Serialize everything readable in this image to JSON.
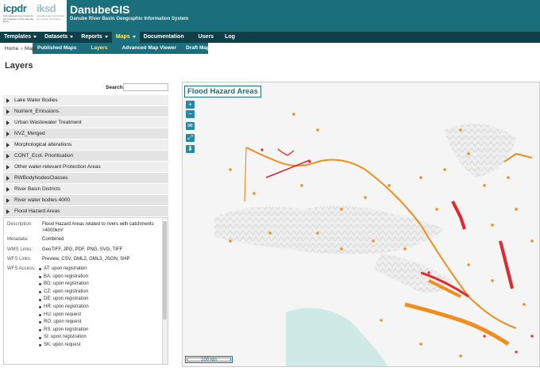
{
  "header": {
    "logo_icpdr": "icpdr",
    "logo_iksd": "iksd",
    "logo_sub": "International Commission for the Protection of the Danube River",
    "logo_sub2": "Internationale Kommission zum Schutz der Donau",
    "title": "DanubeGIS",
    "subtitle": "Danube River Basin Geographic Information System"
  },
  "mainnav": {
    "items": [
      {
        "label": "Templates",
        "caret": true
      },
      {
        "label": "Datasets",
        "caret": true
      },
      {
        "label": "Reports",
        "caret": true
      },
      {
        "label": "Maps",
        "caret": true,
        "active": true
      },
      {
        "label": "Documentation"
      },
      {
        "label": "Users"
      },
      {
        "label": "Log"
      }
    ]
  },
  "subnav": {
    "items": [
      "Published Maps",
      "Layers",
      "Advanced Map Viewer",
      "Draft Maps"
    ],
    "active_index": 1
  },
  "breadcrumb": {
    "home": "Home",
    "sep": "»",
    "current": "Maps"
  },
  "page_title": "Layers",
  "search": {
    "label": "Search:",
    "value": ""
  },
  "layers": [
    "Lake Water Bodies",
    "Nutrient_Emissions",
    "Urban Wastewater Treatment",
    "NVZ_Merged",
    "Morphological alterations",
    "CONT_Ecol. Prioritisation",
    "Other water-relevant Protection Areas",
    "RWBodyNodesClasses",
    "River Basin Districts",
    "River water bodies 4000",
    "Flood Hazard Areas"
  ],
  "detail": {
    "description_label": "Description:",
    "description": "Flood Hazard Areas related to rivers with catchments >4000km²",
    "metadata_label": "Metadata:",
    "metadata": "Combined",
    "wms_label": "WMS Links:",
    "wms": "GeoTIFF, JPG, PDF, PNG, SVG, TIFF",
    "wfs_links_label": "WFS Links:",
    "wfs_links": "Preview, CSV, GML2, GML3, JSON, SHP",
    "wfs_access_label": "WFS Access:",
    "wfs_access": [
      "AT: upon registration",
      "BA: upon registration",
      "BG: upon registration",
      "CZ: upon registration",
      "DE: upon registration",
      "HR: upon registration",
      "HU: upon request",
      "RO: upon request",
      "RS: upon registration",
      "SI: upon registration",
      "SK: upon request"
    ]
  },
  "map": {
    "title": "Flood Hazard Areas",
    "controls": [
      "+",
      "−",
      "✉",
      "⤢",
      "⬇"
    ],
    "scale": "100 km",
    "colors": {
      "flood_high": "#e8232a",
      "flood_medium": "#f28c1c",
      "water": "#cfeae6",
      "terrain": "#f2f2f2"
    }
  }
}
